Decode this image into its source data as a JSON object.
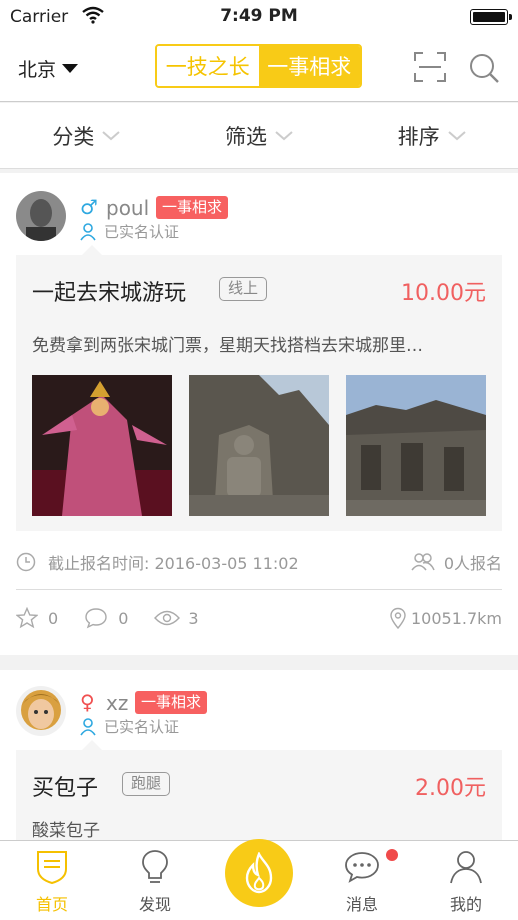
{
  "status_bar": {
    "carrier": "Carrier",
    "time": "7:49 PM"
  },
  "nav": {
    "city": "北京",
    "segments": [
      {
        "label": "一技之长",
        "selected": false
      },
      {
        "label": "一事相求",
        "selected": true
      }
    ],
    "icons": [
      "scan-icon",
      "search-icon"
    ]
  },
  "filters": [
    {
      "label": "分类"
    },
    {
      "label": "筛选"
    },
    {
      "label": "排序"
    }
  ],
  "posts": [
    {
      "username": "poul",
      "gender": "male",
      "gender_symbol": "♂",
      "tag": "一事相求",
      "verified": "已实名认证",
      "title": "一起去宋城游玩",
      "mode": "线上",
      "price": "10.00元",
      "description": "免费拿到两张宋城门票，星期天找搭档去宋城那里…",
      "deadline": "截止报名时间: 2016-03-05 11:02",
      "signups": "0人报名",
      "stars": "0",
      "comments": "0",
      "views": "3",
      "distance": "10051.7km"
    },
    {
      "username": "xz",
      "gender": "female",
      "gender_symbol": "♀",
      "tag": "一事相求",
      "verified": "已实名认证",
      "title": "买包子",
      "mode": "跑腿",
      "price": "2.00元",
      "description": "酸菜包子"
    }
  ],
  "tabbar": {
    "items": [
      {
        "label": "首页",
        "active": true
      },
      {
        "label": "发现",
        "active": false
      },
      {
        "label": "消息",
        "active": false,
        "has_badge": true
      },
      {
        "label": "我的",
        "active": false
      }
    ]
  },
  "colors": {
    "accent_yellow": "#f8cb17",
    "price_red": "#f06060",
    "tag_red": "#f76060",
    "male_blue": "#2ea8e0",
    "female_red": "#f05050"
  }
}
